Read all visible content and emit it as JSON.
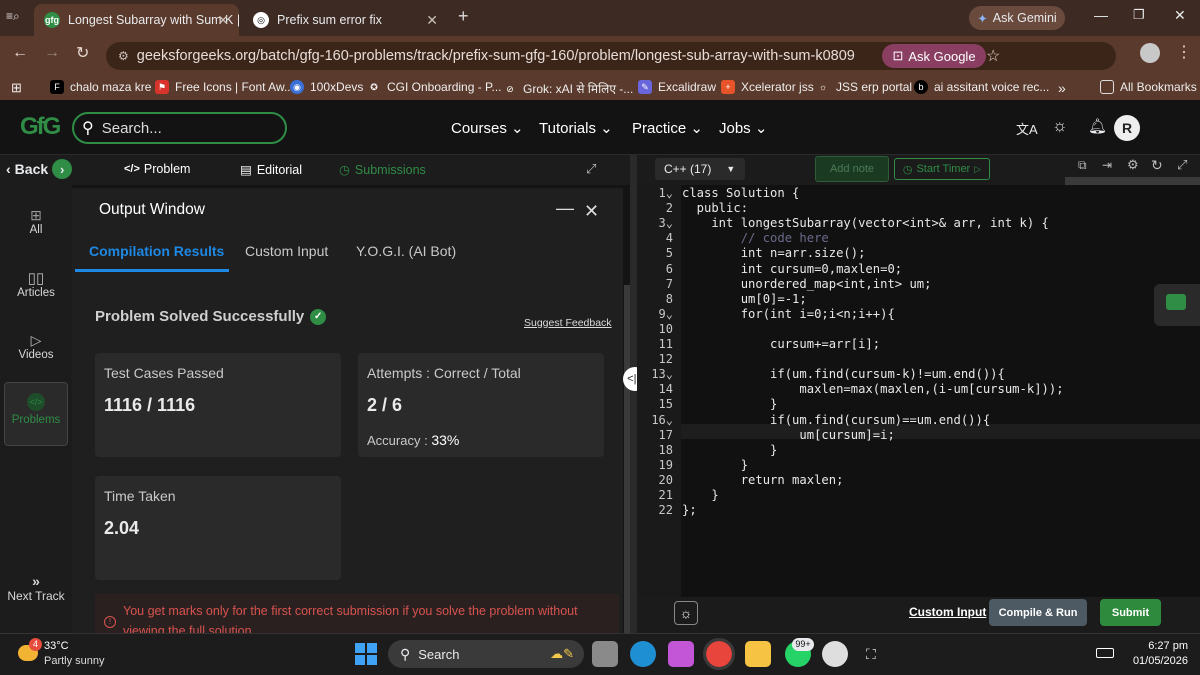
{
  "browser": {
    "tabs": [
      {
        "title": "Longest Subarray with Sum K |",
        "active": true,
        "favicon": "gfg-icon"
      },
      {
        "title": "Prefix sum error fix",
        "active": false,
        "favicon": "chatgpt-icon"
      }
    ],
    "new_tab": "+",
    "gemini_label": "Ask Gemini",
    "url": "geeksforgeeks.org/batch/gfg-160-problems/track/prefix-sum-gfg-160/problem/longest-sub-array-with-sum-k0809",
    "ask_google": "Ask Google",
    "bookmarks": [
      "chalo maza kre",
      "Free Icons | Font Aw...",
      "100xDevs",
      "CGI Onboarding - P...",
      "Grok: xAI से मिलिए -...",
      "Excalidraw",
      "Xcelerator jss",
      "JSS erp portal",
      "ai assitant voice rec..."
    ],
    "bookmarks_more": "»",
    "all_bookmarks": "All Bookmarks"
  },
  "site": {
    "logo": "GfG",
    "search_placeholder": "Search...",
    "nav": [
      "Courses",
      "Tutorials",
      "Practice",
      "Jobs"
    ],
    "avatar_letter": "R"
  },
  "rail": {
    "back": "Back",
    "items": [
      "All",
      "Articles",
      "Videos",
      "Problems"
    ],
    "next_track": "Next Track"
  },
  "problem_tabs": {
    "problem": "Problem",
    "editorial": "Editorial",
    "submissions": "Submissions"
  },
  "output": {
    "title": "Output Window",
    "tabs": [
      "Compilation Results",
      "Custom Input",
      "Y.O.G.I. (AI Bot)"
    ],
    "status": "Problem Solved Successfully",
    "suggest": "Suggest Feedback",
    "tests_label": "Test Cases Passed",
    "tests_value": "1116 / 1116",
    "attempts_label": "Attempts : Correct / Total",
    "attempts_value": "2 / 6",
    "accuracy_label": "Accuracy :",
    "accuracy_value": "33%",
    "time_label": "Time Taken",
    "time_value": "2.04",
    "warning_line1": "You get marks only for the first correct submission if you solve the problem without",
    "warning_line2": "viewing the full solution."
  },
  "editor": {
    "language": "C++ (17)",
    "add_note": "Add note",
    "start_timer": "Start Timer",
    "lines": [
      "class Solution {",
      "  public:",
      "    int longestSubarray(vector<int>& arr, int k) {",
      "        // code here",
      "        int n=arr.size();",
      "        int cursum=0,maxlen=0;",
      "        unordered_map<int,int> um;",
      "        um[0]=-1;",
      "        for(int i=0;i<n;i++){",
      "",
      "            cursum+=arr[i];",
      "",
      "            if(um.find(cursum-k)!=um.end()){",
      "                maxlen=max(maxlen,(i-um[cursum-k]));",
      "            }",
      "            if(um.find(cursum)==um.end()){",
      "                um[cursum]=i;",
      "            }",
      "        }",
      "        return maxlen;",
      "    }",
      "};"
    ],
    "custom_input": "Custom Input",
    "compile_run": "Compile & Run",
    "submit": "Submit"
  },
  "taskbar": {
    "weather_badge": "4",
    "temp": "33°C",
    "weather": "Partly sunny",
    "search": "Search",
    "whatsapp_badge": "99+",
    "time": "6:27 pm",
    "date": "01/05/2026"
  },
  "colors": {
    "gfg_green": "#2f8d46",
    "accent_blue": "#1e88e5",
    "submit_green": "#2e8b3d",
    "warning_red": "#d9534f"
  }
}
